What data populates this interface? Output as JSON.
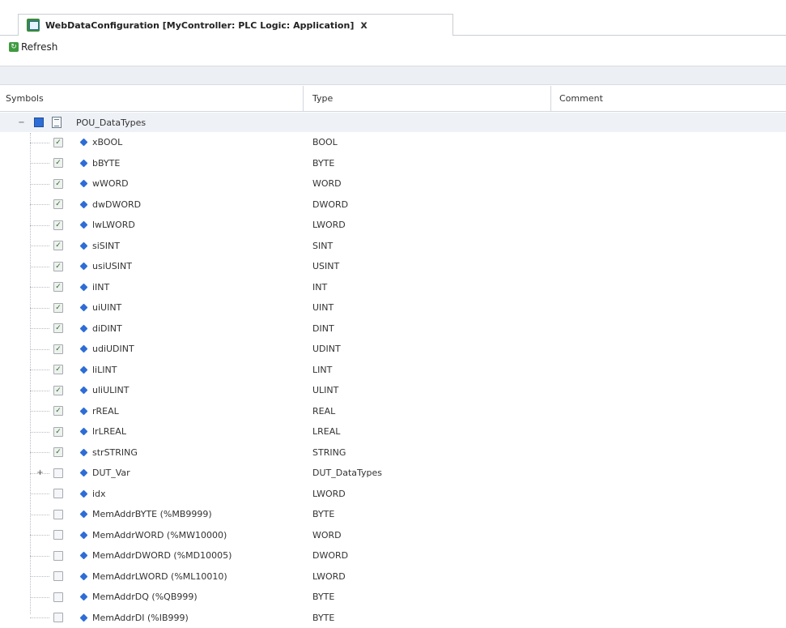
{
  "tab": {
    "title": "WebDataConfiguration [MyController: PLC Logic: Application]",
    "close": "x"
  },
  "toolbar": {
    "refresh_label": "Refresh"
  },
  "grid": {
    "columns": [
      "Symbols",
      "Type",
      "Comment"
    ],
    "root": {
      "name": "POU_DataTypes",
      "expander": "−"
    },
    "rows": [
      {
        "name": "xBOOL",
        "type": "BOOL",
        "checked": true
      },
      {
        "name": "bBYTE",
        "type": "BYTE",
        "checked": true
      },
      {
        "name": "wWORD",
        "type": "WORD",
        "checked": true
      },
      {
        "name": "dwDWORD",
        "type": "DWORD",
        "checked": true
      },
      {
        "name": "lwLWORD",
        "type": "LWORD",
        "checked": true
      },
      {
        "name": "siSINT",
        "type": "SINT",
        "checked": true
      },
      {
        "name": "usiUSINT",
        "type": "USINT",
        "checked": true
      },
      {
        "name": "iINT",
        "type": "INT",
        "checked": true
      },
      {
        "name": "uiUINT",
        "type": "UINT",
        "checked": true
      },
      {
        "name": "diDINT",
        "type": "DINT",
        "checked": true
      },
      {
        "name": "udiUDINT",
        "type": "UDINT",
        "checked": true
      },
      {
        "name": "liLINT",
        "type": "LINT",
        "checked": true
      },
      {
        "name": "uliULINT",
        "type": "ULINT",
        "checked": true
      },
      {
        "name": "rREAL",
        "type": "REAL",
        "checked": true
      },
      {
        "name": "lrLREAL",
        "type": "LREAL",
        "checked": true
      },
      {
        "name": "strSTRING",
        "type": "STRING",
        "checked": true
      },
      {
        "name": "DUT_Var",
        "type": "DUT_DataTypes",
        "checked": false,
        "expander": "+"
      },
      {
        "name": "idx",
        "type": "LWORD",
        "checked": false
      },
      {
        "name": "MemAddrBYTE (%MB9999)",
        "type": "BYTE",
        "checked": false
      },
      {
        "name": "MemAddrWORD (%MW10000)",
        "type": "WORD",
        "checked": false
      },
      {
        "name": "MemAddrDWORD (%MD10005)",
        "type": "DWORD",
        "checked": false
      },
      {
        "name": "MemAddrLWORD (%ML10010)",
        "type": "LWORD",
        "checked": false
      },
      {
        "name": "MemAddrDQ (%QB999)",
        "type": "BYTE",
        "checked": false
      },
      {
        "name": "MemAddrDI (%IB999)",
        "type": "BYTE",
        "checked": false
      }
    ]
  },
  "icons": {
    "tab": "web-config-icon",
    "refresh": "refresh-icon",
    "variable": "variable-diamond-icon",
    "pou": "pou-document-icon"
  },
  "colors": {
    "variable_icon": "#2e6dd6",
    "band": "#eceff3",
    "root_row": "#eef1f5"
  }
}
